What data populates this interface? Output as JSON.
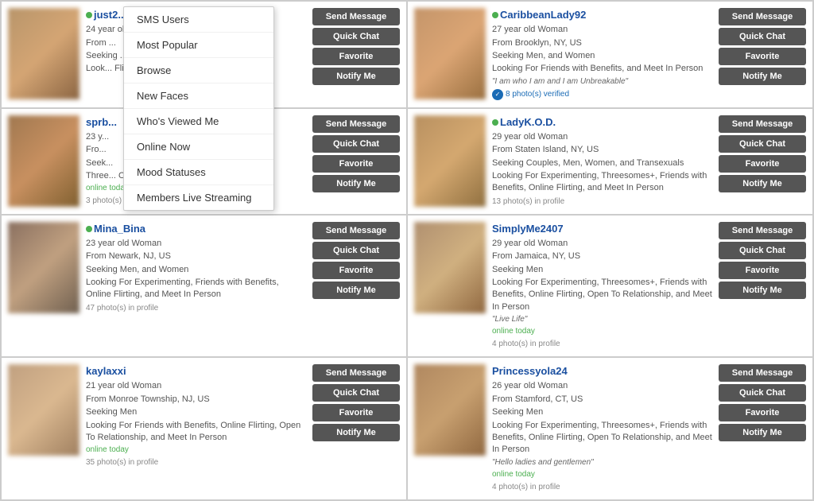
{
  "dropdown": {
    "items": [
      {
        "id": "sms-users",
        "label": "SMS Users"
      },
      {
        "id": "most-popular",
        "label": "Most Popular"
      },
      {
        "id": "browse",
        "label": "Browse"
      },
      {
        "id": "new-faces",
        "label": "New Faces"
      },
      {
        "id": "whos-viewed-me",
        "label": "Who's Viewed Me"
      },
      {
        "id": "online-now",
        "label": "Online Now"
      },
      {
        "id": "mood-statuses",
        "label": "Mood Statuses"
      },
      {
        "id": "members-live-streaming",
        "label": "Members Live Streaming"
      }
    ]
  },
  "profiles": [
    {
      "id": "just2",
      "name": "just2...",
      "age": "24",
      "gender": "year old",
      "location": "From ...",
      "seeking": "Seeking ...",
      "description": "Look...\nFlirt...\nIn Pe...",
      "online_status": "online",
      "photos": "",
      "verified": false,
      "photo_class": "profile-photo-1"
    },
    {
      "id": "caribbeanlady92",
      "name": "CaribbeanLady92",
      "age": "27",
      "gender": "year old Woman",
      "location": "From Brooklyn, NY, US",
      "seeking": "Seeking Men, and Women",
      "description": "Looking For Friends with Benefits, and Meet In Person",
      "quote": "\"I am who I am and I am Unbreakable\"",
      "online_status": "online",
      "photos": "8 photo(s) verified",
      "verified": true,
      "photo_class": "profile-photo-2"
    },
    {
      "id": "sprb",
      "name": "sprb...",
      "age": "23",
      "gender": "y...",
      "location": "Fro...",
      "seeking": "Seek...",
      "description": "Three...\nOper...\nPerson",
      "online_status": "online_today",
      "photos": "3 photo(s) in profile",
      "verified": false,
      "photo_class": "profile-photo-3"
    },
    {
      "id": "ladykod",
      "name": "LadyK.O.D.",
      "age": "29",
      "gender": "year old Woman",
      "location": "From Staten Island, NY, US",
      "seeking": "Seeking Couples, Men, Women, and Transexuals",
      "description": "Looking For Experimenting, Threesomes+, Friends with Benefits, Online Flirting, and Meet In Person",
      "online_status": "online",
      "photos": "13 photo(s) in profile",
      "verified": false,
      "photo_class": "profile-photo-4"
    },
    {
      "id": "mina_bina",
      "name": "Mina_Bina",
      "age": "23",
      "gender": "year old Woman",
      "location": "From Newark, NJ, US",
      "seeking": "Seeking Men, and Women",
      "description": "Looking For Experimenting, Friends with Benefits, Online Flirting, and Meet In Person",
      "online_status": "online",
      "photos": "47 photo(s) in profile",
      "verified": false,
      "photo_class": "profile-photo-5"
    },
    {
      "id": "simplyme2407",
      "name": "SimplyMe2407",
      "age": "29",
      "gender": "year old Woman",
      "location": "From Jamaica, NY, US",
      "seeking": "Seeking Men",
      "description": "Looking For Experimenting, Threesomes+, Friends with Benefits, Online Flirting, Open To Relationship, and Meet In Person",
      "quote": "\"Live Life\"",
      "online_status": "online_today",
      "photos": "4 photo(s) in profile",
      "verified": false,
      "photo_class": "profile-photo-6"
    },
    {
      "id": "kaylaxxi",
      "name": "kaylaxxi",
      "age": "21",
      "gender": "year old Woman",
      "location": "From Monroe Township, NJ, US",
      "seeking": "Seeking Men",
      "description": "Looking For Friends with Benefits, Online Flirting, Open To Relationship, and Meet In Person",
      "online_status": "online_today",
      "photos": "35 photo(s) in profile",
      "verified": false,
      "photo_class": "profile-photo-7"
    },
    {
      "id": "princessyola24",
      "name": "Princessyola24",
      "age": "26",
      "gender": "year old Woman",
      "location": "From Stamford, CT, US",
      "seeking": "Seeking Men",
      "description": "Looking For Experimenting, Threesomes+, Friends with Benefits, Online Flirting, Open To Relationship, and Meet In Person",
      "quote": "\"Hello ladies and gentlemen\"",
      "online_status": "online_today",
      "photos": "4 photo(s) in profile",
      "verified": false,
      "photo_class": "profile-photo-8"
    }
  ],
  "buttons": {
    "send_message": "Send Message",
    "quick_chat": "Quick Chat",
    "favorite": "Favorite",
    "notify_me": "Notify Me"
  }
}
